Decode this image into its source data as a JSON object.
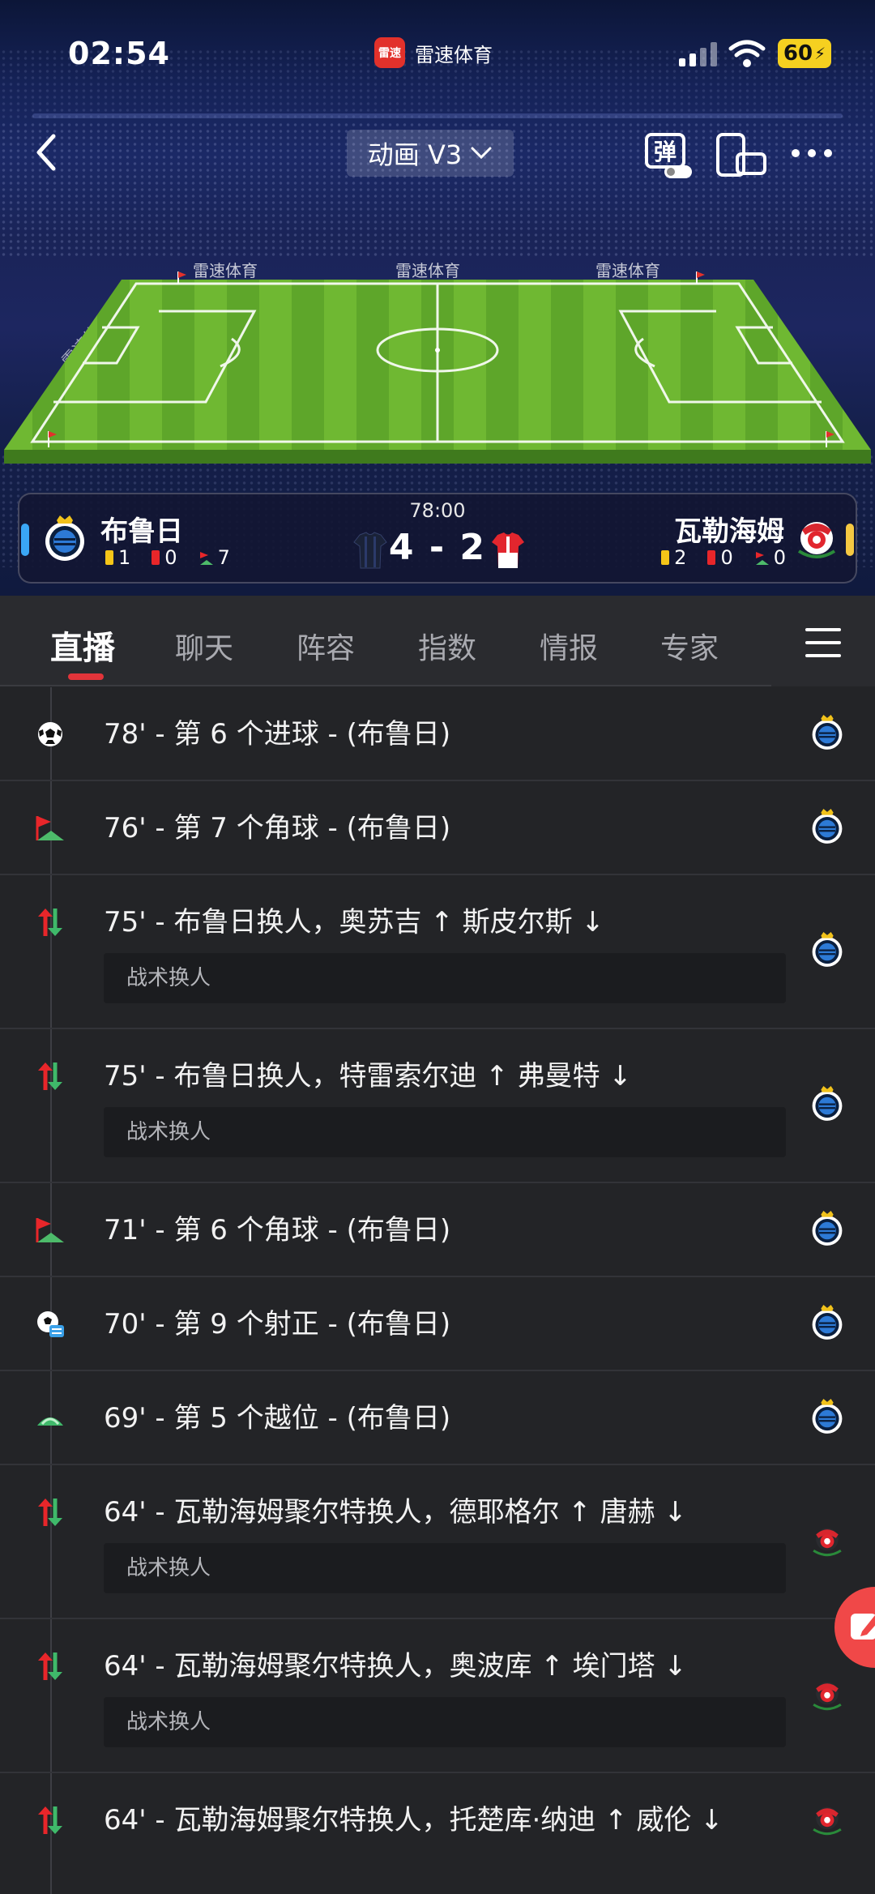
{
  "status_bar": {
    "time": "02:54",
    "app_badge_icon_text": "雷速",
    "app_name": "雷速体育",
    "battery": "60"
  },
  "header": {
    "mode_label": "动画 V3",
    "danmu_label": "弹"
  },
  "stadium_boards": [
    "雷速体育",
    "雷速体育",
    "雷速体育",
    "雷速体育",
    "雷速体育"
  ],
  "match": {
    "time": "78:00",
    "score": "4 - 2",
    "home": {
      "name": "布鲁日",
      "yellow": "1",
      "red": "0",
      "corners": "7",
      "color": "#3aa6f5"
    },
    "away": {
      "name": "瓦勒海姆",
      "yellow": "2",
      "red": "0",
      "corners": "0",
      "color": "#f5c842"
    }
  },
  "tabs": [
    {
      "label": "直播",
      "active": true
    },
    {
      "label": "聊天"
    },
    {
      "label": "阵容"
    },
    {
      "label": "指数"
    },
    {
      "label": "情报"
    },
    {
      "label": "专家"
    }
  ],
  "events": [
    {
      "type": "goal-icon",
      "text": "78' - 第 6 个进球 - (布鲁日)",
      "team": "home"
    },
    {
      "type": "corner-icon",
      "text": "76' - 第 7 个角球 - (布鲁日)",
      "team": "home"
    },
    {
      "type": "substitution-icon",
      "text": "75' - 布鲁日换人，奥苏吉 ↑ 斯皮尔斯 ↓",
      "note": "战术换人",
      "team": "home"
    },
    {
      "type": "substitution-icon",
      "text": "75' - 布鲁日换人，特雷索尔迪 ↑ 弗曼特 ↓",
      "note": "战术换人",
      "team": "home"
    },
    {
      "type": "corner-icon",
      "text": "71' - 第 6 个角球 - (布鲁日)",
      "team": "home"
    },
    {
      "type": "shot-on-target-icon",
      "text": "70' - 第 9 个射正 - (布鲁日)",
      "team": "home"
    },
    {
      "type": "offside-icon",
      "text": "69' - 第 5 个越位 - (布鲁日)",
      "team": "home"
    },
    {
      "type": "substitution-icon",
      "text": "64' - 瓦勒海姆聚尔特换人，德耶格尔 ↑ 唐赫 ↓",
      "note": "战术换人",
      "team": "away"
    },
    {
      "type": "substitution-icon",
      "text": "64' - 瓦勒海姆聚尔特换人，奥波库 ↑ 埃门塔 ↓",
      "note": "战术换人",
      "team": "away"
    },
    {
      "type": "substitution-icon",
      "text": "64' - 瓦勒海姆聚尔特换人，托楚库·纳迪 ↑ 威伦 ↓",
      "team": "away"
    }
  ]
}
